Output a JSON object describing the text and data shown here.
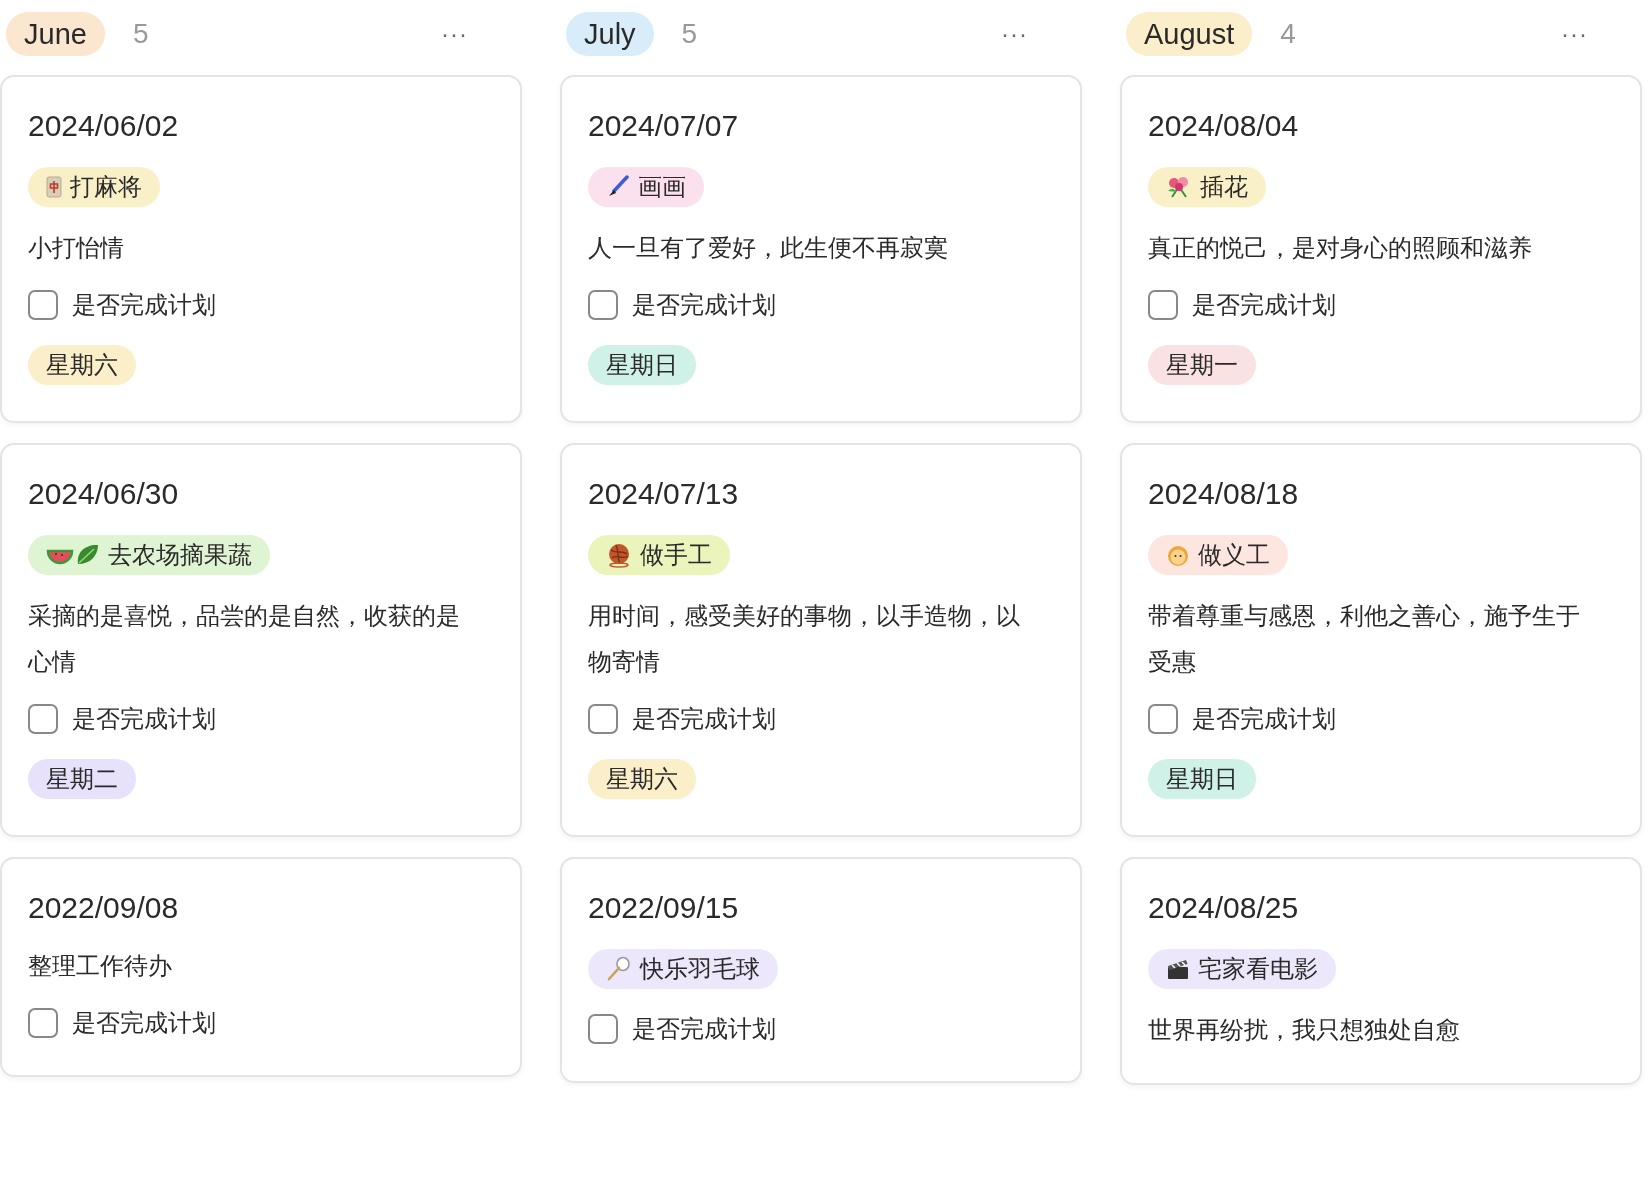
{
  "columns": [
    {
      "title": "June",
      "color": "#fbe6d0",
      "count": "5",
      "more": "···",
      "cards": [
        {
          "date": "2024/06/02",
          "tag": {
            "label": "打麻将",
            "color": "#faf0c8"
          },
          "note": "小打怡情",
          "checkbox": {
            "label": "是否完成计划",
            "checked": false
          },
          "weekday": {
            "label": "星期六",
            "color": "#faefc9"
          }
        },
        {
          "date": "2024/06/30",
          "tag": {
            "label": "去农场摘果蔬",
            "color": "#dff4d2"
          },
          "note": "采摘的是喜悦，品尝的是自然，收获的是心情",
          "checkbox": {
            "label": "是否完成计划",
            "checked": false
          },
          "weekday": {
            "label": "星期二",
            "color": "#e7e1fb"
          }
        },
        {
          "date": "2022/09/08",
          "note": "整理工作待办",
          "checkbox": {
            "label": "是否完成计划",
            "checked": false
          }
        }
      ]
    },
    {
      "title": "July",
      "color": "#d8edf9",
      "count": "5",
      "more": "···",
      "cards": [
        {
          "date": "2024/07/07",
          "tag": {
            "label": "画画",
            "color": "#fbe1ee"
          },
          "note": "人一旦有了爱好，此生便不再寂寞",
          "checkbox": {
            "label": "是否完成计划",
            "checked": false
          },
          "weekday": {
            "label": "星期日",
            "color": "#d0f1e7"
          }
        },
        {
          "date": "2024/07/13",
          "tag": {
            "label": "做手工",
            "color": "#eaf4bb"
          },
          "note": "用时间，感受美好的事物，以手造物，以物寄情",
          "checkbox": {
            "label": "是否完成计划",
            "checked": false
          },
          "weekday": {
            "label": "星期六",
            "color": "#faefc9"
          }
        },
        {
          "date": "2022/09/15",
          "tag": {
            "label": "快乐羽毛球",
            "color": "#ece7fb"
          },
          "checkbox": {
            "label": "是否完成计划",
            "checked": false
          }
        }
      ]
    },
    {
      "title": "August",
      "color": "#faefca",
      "count": "4",
      "more": "···",
      "cards": [
        {
          "date": "2024/08/04",
          "tag": {
            "label": "插花",
            "color": "#faf0c8"
          },
          "note": "真正的悦己，是对身心的照顾和滋养",
          "checkbox": {
            "label": "是否完成计划",
            "checked": false
          },
          "weekday": {
            "label": "星期一",
            "color": "#fbe2e2"
          }
        },
        {
          "date": "2024/08/18",
          "tag": {
            "label": "做义工",
            "color": "#fde6df"
          },
          "note": "带着尊重与感恩，利他之善心，施予生于受惠",
          "checkbox": {
            "label": "是否完成计划",
            "checked": false
          },
          "weekday": {
            "label": "星期日",
            "color": "#d0f1e7"
          }
        },
        {
          "date": "2024/08/25",
          "tag": {
            "label": "宅家看电影",
            "color": "#ece7fb"
          },
          "note": "世界再纷扰，我只想独处自愈"
        }
      ]
    }
  ]
}
